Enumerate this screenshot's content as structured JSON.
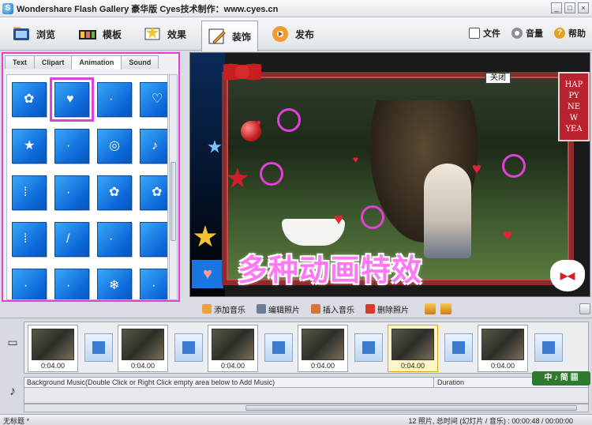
{
  "window": {
    "title": "Wondershare Flash Gallery 豪华版 Cyes技术制作：www.cyes.cn",
    "logo_char": "S",
    "minimize": "_",
    "restore": "□",
    "close": "×"
  },
  "toolbar": {
    "tools": [
      {
        "label": "浏览",
        "icon": "browse-icon"
      },
      {
        "label": "模板",
        "icon": "template-icon"
      },
      {
        "label": "效果",
        "icon": "effects-icon"
      },
      {
        "label": "装饰",
        "icon": "decorate-icon",
        "active": true
      },
      {
        "label": "发布",
        "icon": "publish-icon"
      }
    ],
    "right": [
      {
        "label": "文件",
        "icon": "file-icon"
      },
      {
        "label": "音量",
        "icon": "volume-icon"
      },
      {
        "label": "帮助",
        "icon": "help-icon"
      }
    ]
  },
  "left_panel": {
    "tabs": [
      "Text",
      "Clipart",
      "Animation",
      "Sound"
    ],
    "active_tab": "Animation",
    "thumbnails": [
      {
        "glyph": "✿"
      },
      {
        "glyph": "♥",
        "selected": true
      },
      {
        "glyph": "·"
      },
      {
        "glyph": "♡"
      },
      {
        "glyph": "★"
      },
      {
        "glyph": "·"
      },
      {
        "glyph": "◎"
      },
      {
        "glyph": "♪"
      },
      {
        "glyph": "⁞"
      },
      {
        "glyph": "·"
      },
      {
        "glyph": "✿"
      },
      {
        "glyph": "✿"
      },
      {
        "glyph": "⁞"
      },
      {
        "glyph": "/"
      },
      {
        "glyph": "·"
      },
      {
        "glyph": " "
      },
      {
        "glyph": "·"
      },
      {
        "glyph": "·"
      },
      {
        "glyph": "❄"
      },
      {
        "glyph": "·"
      }
    ]
  },
  "preview": {
    "close_label": "关闭",
    "happy_text": [
      "HAP",
      "PY",
      "NE",
      "W",
      "YEA"
    ],
    "caption": "多种动画特效",
    "heart_glyph": "♥",
    "play_glyph": "▶◀"
  },
  "actions": [
    {
      "label": "添加音乐",
      "icon": "add-music-icon"
    },
    {
      "label": "编辑照片",
      "icon": "edit-photo-icon"
    },
    {
      "label": "插入音乐",
      "icon": "insert-music-icon"
    },
    {
      "label": "删除照片",
      "icon": "delete-photo-icon"
    }
  ],
  "timeline": {
    "slides": [
      {
        "time": "0:04.00",
        "selected": false
      },
      {
        "time": "0:04.00",
        "selected": false
      },
      {
        "time": "0:04.00",
        "selected": false
      },
      {
        "time": "0:04.00",
        "selected": false
      },
      {
        "time": "0:04.00",
        "selected": true
      },
      {
        "time": "0:04.00",
        "selected": false
      }
    ],
    "photo_track_icon": "▭",
    "music_track_icon": "♪",
    "music_hint": "Background Music(Double Click or Right Click empty area below to Add Music)",
    "duration_label": "Duration",
    "badge": "中 ♪ 简 ▦"
  },
  "status": {
    "left": "无标题 *",
    "right": "12 照片, 总时间 (幻灯片 / 音乐) : 00:00:48 / 00:00:00"
  },
  "colors": {
    "highlight": "#e040d8",
    "thumb_blue": "#0b67d8",
    "caption_pink": "#ff7af2"
  }
}
